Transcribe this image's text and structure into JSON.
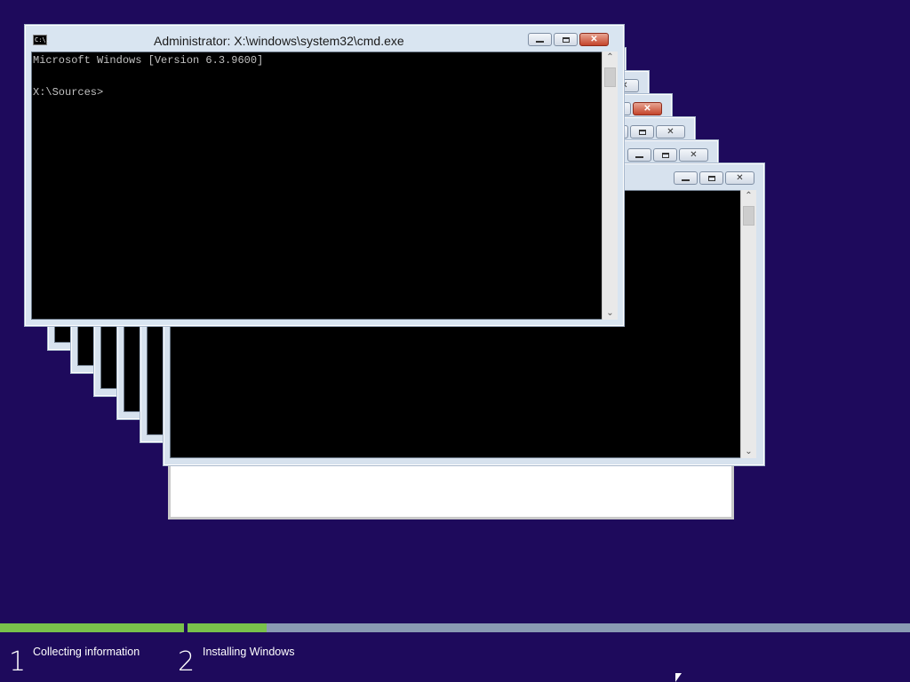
{
  "main_window": {
    "title": "Administrator: X:\\windows\\system32\\cmd.exe",
    "icon": "cmd-icon",
    "icon_text": "C:\\.",
    "console_lines": [
      "Microsoft Windows [Version 6.3.9600]",
      "",
      "X:\\Sources>"
    ]
  },
  "stacked_windows": {
    "count": 6,
    "icons": [
      "minimize-icon",
      "maximize-icon",
      "close-icon"
    ]
  },
  "setup": {
    "steps": [
      {
        "number": "1",
        "label": "Collecting information",
        "progress": 1.0
      },
      {
        "number": "2",
        "label": "Installing Windows",
        "progress": 0.11
      }
    ],
    "colors": {
      "background": "#1e0a5c",
      "progress_fill": "#79c14b",
      "progress_track": "#8a9ab3"
    }
  }
}
